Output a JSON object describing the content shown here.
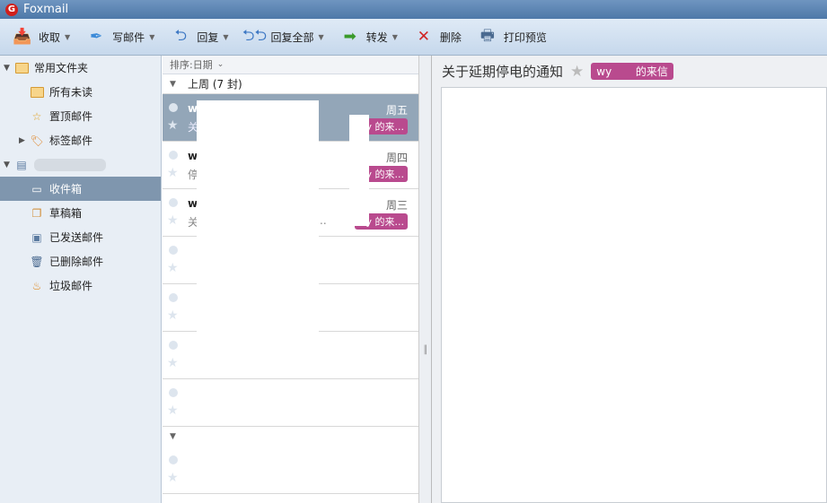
{
  "app": {
    "title": "Foxmail"
  },
  "toolbar": {
    "receive": "收取",
    "compose": "写邮件",
    "reply": "回复",
    "reply_all": "回复全部",
    "forward": "转发",
    "delete": "删除",
    "print_preview": "打印预览"
  },
  "sidebar": {
    "common": "常用文件夹",
    "unread": "所有未读",
    "pinned": "置顶邮件",
    "tagged": "标签邮件",
    "inbox": "收件箱",
    "drafts": "草稿箱",
    "sent": "已发送邮件",
    "deleted": "已删除邮件",
    "junk": "垃圾邮件"
  },
  "list": {
    "sort": "排序:日期",
    "group": "上周 (7 封)",
    "messages": [
      {
        "from": "w",
        "subject": "关",
        "day": "周五",
        "tag": "wy    的来..."
      },
      {
        "from": "w",
        "subject": "停",
        "day": "周四",
        "tag": "wy    的来..."
      },
      {
        "from": "w",
        "subject": "关",
        "day": "周三",
        "tag": "wy    的来...",
        "ellipsis": ".."
      }
    ]
  },
  "reader": {
    "subject": "关于延期停电的通知",
    "tag": "wy       的来信"
  },
  "colors": {
    "tag": "#b94a8e",
    "selected": "#7f96ae"
  }
}
